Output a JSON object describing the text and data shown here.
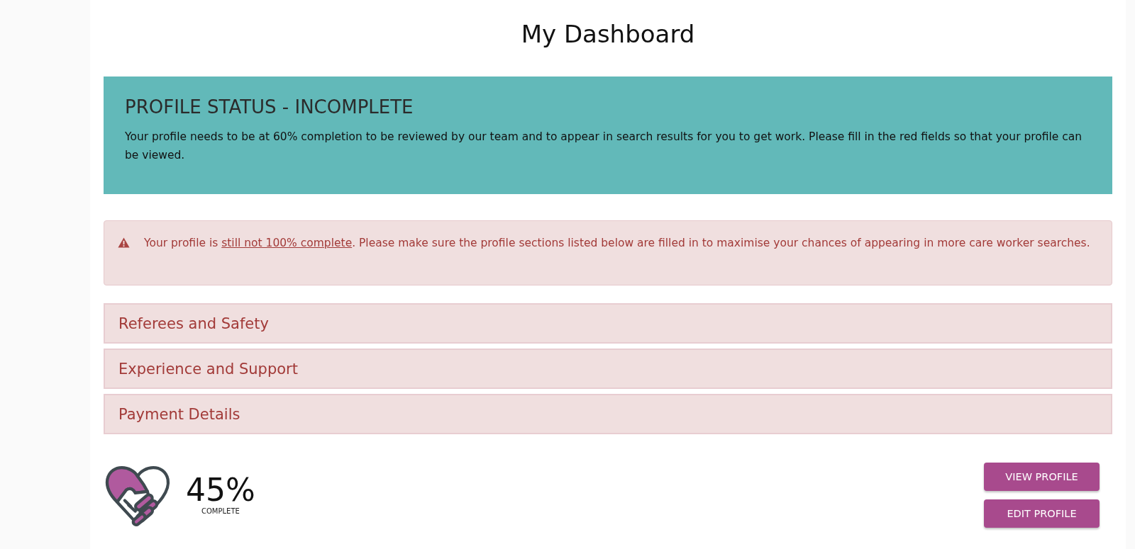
{
  "page_title": "My Dashboard",
  "status_panel": {
    "title": "PROFILE STATUS - INCOMPLETE",
    "text": "Your profile needs to be at 60% completion to be reviewed by our team and to appear in search results for you to get work. Please fill in the red fields so that your profile can be viewed."
  },
  "alert": {
    "text_before": "Your profile is ",
    "link": "still not 100% complete",
    "text_after": ". Please make sure the profile sections listed below are filled in to maximise your chances of appearing in more care worker searches."
  },
  "sections": [
    {
      "label": "Referees and Safety"
    },
    {
      "label": "Experience and Support"
    },
    {
      "label": "Payment Details"
    }
  ],
  "progress": {
    "percent": "45%",
    "caption": "COMPLETE"
  },
  "buttons": [
    {
      "label": "VIEW PROFILE"
    },
    {
      "label": "EDIT PROFILE"
    }
  ]
}
